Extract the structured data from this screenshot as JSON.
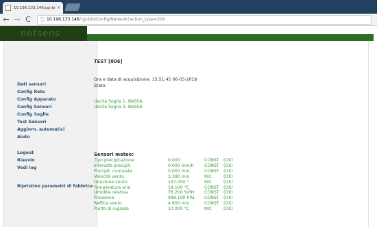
{
  "browser": {
    "tab_title": "10.196.133.146/cgi-bin/",
    "tab_close": "×",
    "url_host": "10.196.133.146",
    "url_path": "/cgi-bin/Config/Network?action_type=200",
    "info_icon": "ⓘ",
    "back_icon": "←",
    "forward_icon": "→",
    "reload_icon": "C"
  },
  "logo": {
    "text": "netsens"
  },
  "sidebar": {
    "items": [
      {
        "label": "Dati sensori"
      },
      {
        "label": "Config Rete"
      },
      {
        "label": "Config Apparato"
      },
      {
        "label": "Config Sensori"
      },
      {
        "label": "Config Soglie"
      },
      {
        "label": "Test Sensori"
      },
      {
        "label": "Aggiorn. automatici"
      },
      {
        "label": "Aiuto"
      },
      {
        "label": "Logout"
      },
      {
        "label": "Riavvio"
      },
      {
        "label": "Vedi log"
      },
      {
        "label": "Ripristino parametri di fabbrica"
      }
    ]
  },
  "content": {
    "title": "TEST [806]",
    "acquisition_label": "Ora e data di acquisizione:",
    "acquisition_value": "15:51:45 06-03-2018",
    "stato_label": "Stato:",
    "soglie": [
      "Uscita Soglia 1: BASSA",
      "Uscita Soglia 2: BASSA"
    ],
    "meteo_title": "Sensori meteo:",
    "meteo_rows": [
      {
        "name": "Tipo precipitazione",
        "value": "0.000",
        "type": "CONST",
        "status": "(OK)"
      },
      {
        "name": "Intensità precipit.",
        "value": "0.000 mm/h",
        "type": "CONST",
        "status": "(OK)"
      },
      {
        "name": "Precipit. cumulata",
        "value": "0.000 mm",
        "type": "CONST",
        "status": "(OK)"
      },
      {
        "name": "Velocità vento",
        "value": "3.380 m/s",
        "type": "INC",
        "status": "(OK)"
      },
      {
        "name": "Direzione vento",
        "value": "197.000 °",
        "type": "INC",
        "status": "(OK)"
      },
      {
        "name": "Temperatura aria",
        "value": "14.100 °C",
        "type": "CONST",
        "status": "(OK)"
      },
      {
        "name": "Umidità relativa",
        "value": "76.200 %RH",
        "type": "CONST",
        "status": "(OK)"
      },
      {
        "name": "Pressione",
        "value": "988.100 hPa",
        "type": "CONST",
        "status": "(OK)"
      },
      {
        "name": "Raffica vento",
        "value": "4.800 m/s",
        "type": "CONST",
        "status": "(OK)"
      },
      {
        "name": "Punto di rugiada",
        "value": "10.000 °C",
        "type": "INC",
        "status": "(OK)"
      }
    ]
  },
  "colors": {
    "header_dark": "#1f3f17",
    "header_green": "#2f6b25",
    "sidebar_link": "#2c5070",
    "value_green": "#3a9a3a"
  }
}
